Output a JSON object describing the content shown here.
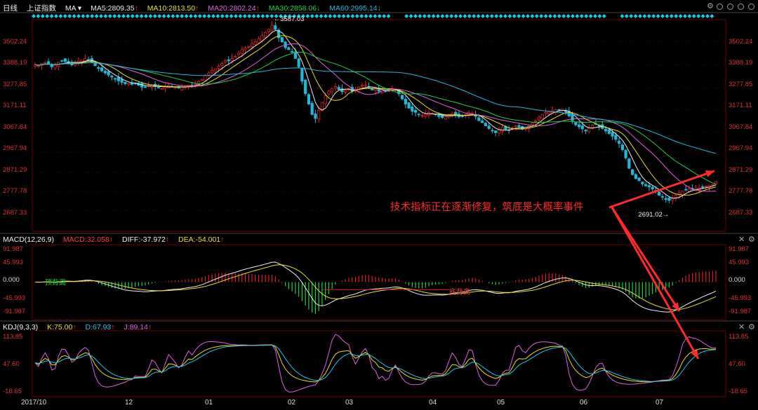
{
  "header": {
    "period": "日线",
    "index": "上证指数",
    "indicator": "MA",
    "ma": [
      {
        "label": "MA5:2809.35",
        "arrow": "↑",
        "color": "#e8e8e8"
      },
      {
        "label": "MA10:2813.50",
        "arrow": "↑",
        "color": "#e8e020"
      },
      {
        "label": "MA20:2802.24",
        "arrow": "↑",
        "color": "#e060e0"
      },
      {
        "label": "MA30:2858.06",
        "arrow": "↓",
        "color": "#20d040"
      },
      {
        "label": "MA60:2995.14",
        "arrow": "↓",
        "color": "#20b8e0"
      }
    ]
  },
  "macd_header": {
    "title": "MACD(12,26,9)",
    "macd": "MACD:32.058",
    "macd_arrow": "↑",
    "diff": "DIFF:-37.972",
    "diff_arrow": "↑",
    "dea": "DEA:-54.001",
    "dea_arrow": "↑"
  },
  "kdj_header": {
    "title": "KDJ(9,3,3)",
    "k": "K:75.00",
    "k_arrow": "↑",
    "d": "D:67.93",
    "d_arrow": "↑",
    "j": "J:89.14",
    "j_arrow": "↑"
  },
  "annotation": "技术指标正在逐渐修复，筑底是大概率事件",
  "chart_data": [
    {
      "type": "candlestick",
      "price_axis_labels": [
        "3502.24",
        "3388.19",
        "3277.85",
        "3171.11",
        "3067.84",
        "2967.94",
        "2871.29",
        "2777.78",
        "2687.33"
      ],
      "price_axis_values": [
        3502.24,
        3388.19,
        3277.85,
        3171.11,
        3067.84,
        2967.94,
        2871.29,
        2777.78,
        2687.33
      ],
      "x_labels": [
        "2017/10",
        "12",
        "01",
        "02",
        "03",
        "04",
        "05",
        "06",
        "07"
      ],
      "high_label": "3587.03",
      "low_label": "2691.02",
      "close": [
        3390,
        3385,
        3395,
        3400,
        3392,
        3380,
        3388,
        3402,
        3410,
        3405,
        3398,
        3392,
        3400,
        3408,
        3412,
        3420,
        3415,
        3400,
        3385,
        3372,
        3360,
        3350,
        3340,
        3330,
        3322,
        3312,
        3305,
        3298,
        3300,
        3295,
        3300,
        3290,
        3282,
        3280,
        3288,
        3292,
        3285,
        3280,
        3275,
        3285,
        3290,
        3282,
        3280,
        3277,
        3282,
        3288,
        3292,
        3286,
        3296,
        3308,
        3320,
        3338,
        3350,
        3362,
        3370,
        3382,
        3395,
        3410,
        3408,
        3420,
        3430,
        3445,
        3462,
        3470,
        3478,
        3492,
        3500,
        3515,
        3530,
        3545,
        3560,
        3580,
        3560,
        3520,
        3500,
        3472,
        3462,
        3450,
        3420,
        3380,
        3310,
        3250,
        3200,
        3150,
        3130,
        3170,
        3208,
        3240,
        3262,
        3275,
        3285,
        3270,
        3260,
        3268,
        3275,
        3262,
        3270,
        3282,
        3290,
        3292,
        3280,
        3268,
        3272,
        3262,
        3270,
        3260,
        3265,
        3275,
        3270,
        3250,
        3225,
        3200,
        3180,
        3165,
        3160,
        3150,
        3145,
        3152,
        3160,
        3155,
        3148,
        3140,
        3135,
        3140,
        3150,
        3155,
        3145,
        3138,
        3140,
        3150,
        3160,
        3155,
        3140,
        3120,
        3110,
        3095,
        3082,
        3070,
        3062,
        3075,
        3085,
        3078,
        3072,
        3085,
        3095,
        3090,
        3082,
        3088,
        3096,
        3108,
        3120,
        3138,
        3150,
        3160,
        3162,
        3168,
        3172,
        3170,
        3175,
        3162,
        3142,
        3120,
        3100,
        3090,
        3080,
        3070,
        3085,
        3098,
        3102,
        3092,
        3082,
        3070,
        3058,
        3045,
        3030,
        3010,
        2980,
        2940,
        2890,
        2860,
        2840,
        2830,
        2815,
        2805,
        2800,
        2790,
        2780,
        2760,
        2750,
        2740,
        2735,
        2745,
        2760,
        2770,
        2780,
        2785,
        2790,
        2788,
        2792,
        2796,
        2800,
        2804,
        2808,
        2812,
        2826
      ],
      "ma60_end": 2995.14,
      "ma30_end": 2858.06,
      "ma20_end": 2802.24,
      "ma10_end": 2813.5,
      "ma5_end": 2809.35
    },
    {
      "type": "bar",
      "name": "MACD",
      "axis_labels": [
        "91.987",
        "45.993",
        "0.000",
        "-45.993",
        "-91.987"
      ],
      "axis_values": [
        91.987,
        45.993,
        0,
        -45.993,
        -91.987
      ],
      "annotations": [
        "顶背离",
        "底背离"
      ]
    },
    {
      "type": "line",
      "name": "KDJ",
      "axis_labels": [
        "113.85",
        "47.60",
        "-18.65"
      ],
      "axis_values": [
        113.85,
        47.6,
        -18.65
      ]
    }
  ],
  "colors": {
    "up": "#e02020",
    "down": "#20b8d8",
    "grid": "#3a0000",
    "ma5": "#e8e8e8",
    "ma10": "#e8e020",
    "ma20": "#e060e0",
    "ma30": "#20d040",
    "ma60": "#20b8e0",
    "annotation": "#ff2a2a"
  }
}
